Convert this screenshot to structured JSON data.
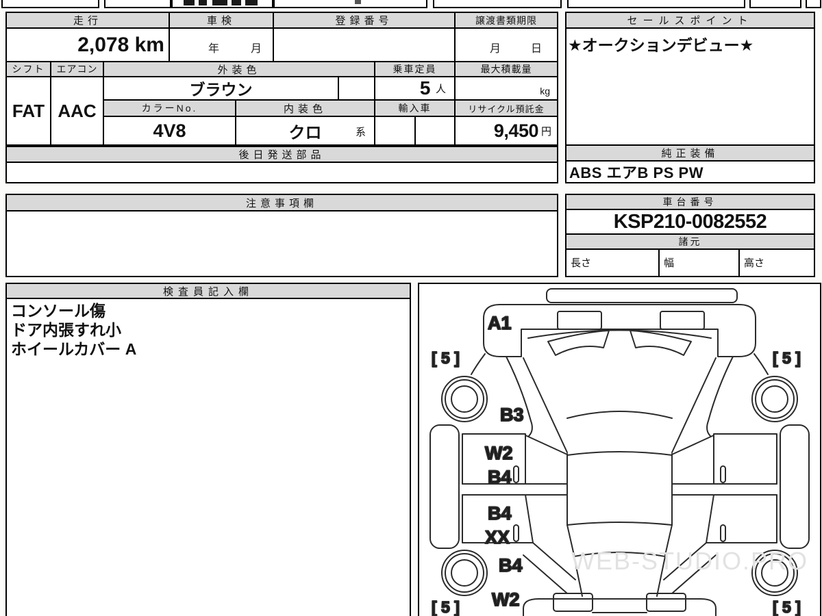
{
  "vehicle_table": {
    "mileage": {
      "header": "走行",
      "value": "2,078 km"
    },
    "shaken": {
      "header": "車検",
      "year_label": "年",
      "month_label": "月"
    },
    "registration": {
      "header": "登録番号",
      "value": ""
    },
    "transfer_deadline": {
      "header": "譲渡書類期限",
      "month_label": "月",
      "day_label": "日"
    },
    "sales_point": {
      "header": "セールスポイント",
      "value": "★オークションデビュー★"
    },
    "shift": {
      "header": "シフト",
      "value": "FAT"
    },
    "aircon": {
      "header": "エアコン",
      "value": "AAC"
    },
    "exterior_color": {
      "header": "外装色",
      "value": "ブラウン"
    },
    "capacity": {
      "header": "乗車定員",
      "value": "5",
      "unit": "人"
    },
    "max_load": {
      "header": "最大積載量",
      "value": "",
      "unit": "kg"
    },
    "color_no": {
      "header": "カラーNo.",
      "value": "4V8"
    },
    "interior_color": {
      "header": "内装色",
      "value": "クロ",
      "suffix": "系"
    },
    "import_car": {
      "header": "輸入車",
      "value": ""
    },
    "recycle_deposit": {
      "header": "リサイクル預託金",
      "value": "9,450",
      "unit": "円"
    },
    "later_parts": {
      "header": "後日発送部品",
      "value": ""
    },
    "genuine_equipment": {
      "header": "純正装備",
      "value": "ABS エアB PS PW"
    }
  },
  "notes": {
    "header": "注意事項欄",
    "value": ""
  },
  "chassis": {
    "header": "車台番号",
    "value": "KSP210-0082552"
  },
  "specs": {
    "header": "諸元",
    "length_label": "長さ",
    "width_label": "幅",
    "height_label": "高さ"
  },
  "inspector": {
    "header": "検査員記入欄",
    "lines": [
      "コンソール傷",
      "ドア内張すれ小",
      "ホイールカバー A"
    ]
  },
  "diagram": {
    "marks": {
      "front_bumper": "A1",
      "front_fender_left": "B3",
      "front_door_upper": "W2",
      "front_door_lower": "B4",
      "rear_door_upper": "B4",
      "rear_door_lower": "XX",
      "rear_fender_left": "B4",
      "rear_panel_left": "W2"
    },
    "tires": {
      "front_left": "[ 5 ]",
      "front_right": "[ 5 ]",
      "rear_left": "[ 5 ]",
      "rear_right": "[ 5 ]"
    },
    "watermark": "WEB-STUDIO.PRO"
  }
}
